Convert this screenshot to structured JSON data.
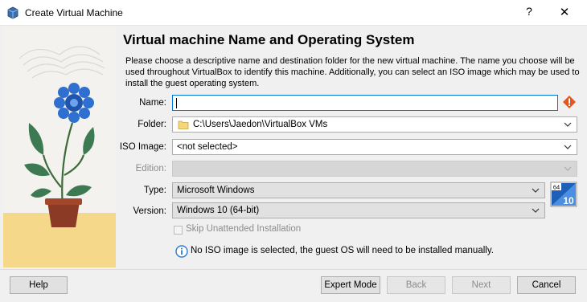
{
  "window": {
    "title": "Create Virtual Machine",
    "help_glyph": "?",
    "close_glyph": "✕"
  },
  "heading": "Virtual machine Name and Operating System",
  "description": "Please choose a descriptive name and destination folder for the new virtual machine. The name you choose will be used throughout VirtualBox to identify this machine. Additionally, you can select an ISO image which may be used to install the guest operating system.",
  "form": {
    "name_label": "Name:",
    "name_value": "",
    "folder_label": "Folder:",
    "folder_value": "C:\\Users\\Jaedon\\VirtualBox VMs",
    "iso_label": "ISO Image:",
    "iso_value": "<not selected>",
    "edition_label": "Edition:",
    "edition_value": "",
    "type_label": "Type:",
    "type_value": "Microsoft Windows",
    "version_label": "Version:",
    "version_value": "Windows 10 (64-bit)",
    "unattended_label": "Skip Unattended Installation",
    "unattended_checked": false,
    "info_text": "No ISO image is selected, the guest OS will need to be installed manually."
  },
  "os_badge": {
    "bits": "64",
    "version": "10"
  },
  "buttons": {
    "help": "Help",
    "expert": "Expert Mode",
    "back": "Back",
    "next": "Next",
    "cancel": "Cancel"
  },
  "colors": {
    "accent": "#0078d7",
    "warning": "#e2561f",
    "flower": "#2f6fd0",
    "pot": "#8b3b25",
    "sand": "#f6d88a"
  }
}
